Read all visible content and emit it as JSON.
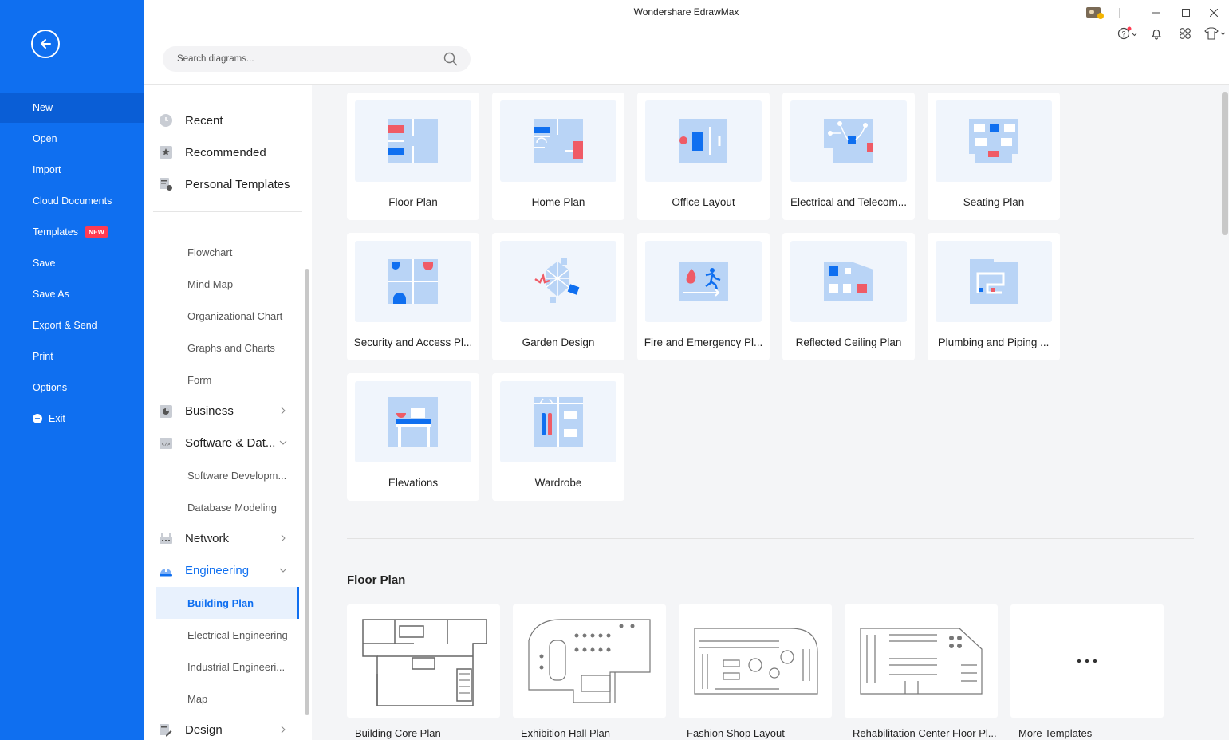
{
  "app": {
    "title": "Wondershare EdrawMax"
  },
  "search": {
    "placeholder": "Search diagrams..."
  },
  "left_nav": {
    "items": [
      {
        "label": "New",
        "active": true
      },
      {
        "label": "Open"
      },
      {
        "label": "Import"
      },
      {
        "label": "Cloud Documents"
      },
      {
        "label": "Templates",
        "badge": "NEW"
      },
      {
        "label": "Save"
      },
      {
        "label": "Save As"
      },
      {
        "label": "Export & Send"
      },
      {
        "label": "Print"
      },
      {
        "label": "Options"
      },
      {
        "label": "Exit"
      }
    ]
  },
  "categories": {
    "top": [
      {
        "label": "Recent",
        "icon": "clock-icon"
      },
      {
        "label": "Recommended",
        "icon": "star-icon"
      },
      {
        "label": "Personal Templates",
        "icon": "personal-template-icon"
      }
    ],
    "general_subitems": [
      "Flowchart",
      "Mind Map",
      "Organizational Chart",
      "Graphs and Charts",
      "Form"
    ],
    "business": "Business",
    "software": "Software & Dat...",
    "software_subitems": [
      "Software Developm...",
      "Database Modeling"
    ],
    "network": "Network",
    "engineering": "Engineering",
    "engineering_subitems": [
      "Building Plan",
      "Electrical Engineering",
      "Industrial Engineeri...",
      "Map"
    ],
    "design": "Design"
  },
  "templates": {
    "cards": [
      "Floor Plan",
      "Home Plan",
      "Office Layout",
      "Electrical and Telecom...",
      "Seating Plan",
      "Security and Access Pl...",
      "Garden Design",
      "Fire and Emergency Pl...",
      "Reflected Ceiling Plan",
      "Plumbing and Piping ...",
      "Elevations",
      "Wardrobe"
    ]
  },
  "section": {
    "title": "Floor Plan",
    "examples": [
      "Building Core Plan",
      "Exhibition Hall Plan",
      "Fashion Shop Layout",
      "Rehabilitation Center Floor Pl...",
      "More Templates"
    ],
    "more_icon": "ellipsis-icon"
  },
  "colors": {
    "brand_blue": "#0f6ff0",
    "accent_red": "#ef5b66",
    "thumb_blue": "#b9d4f6",
    "badge_red": "#ff3b52"
  }
}
